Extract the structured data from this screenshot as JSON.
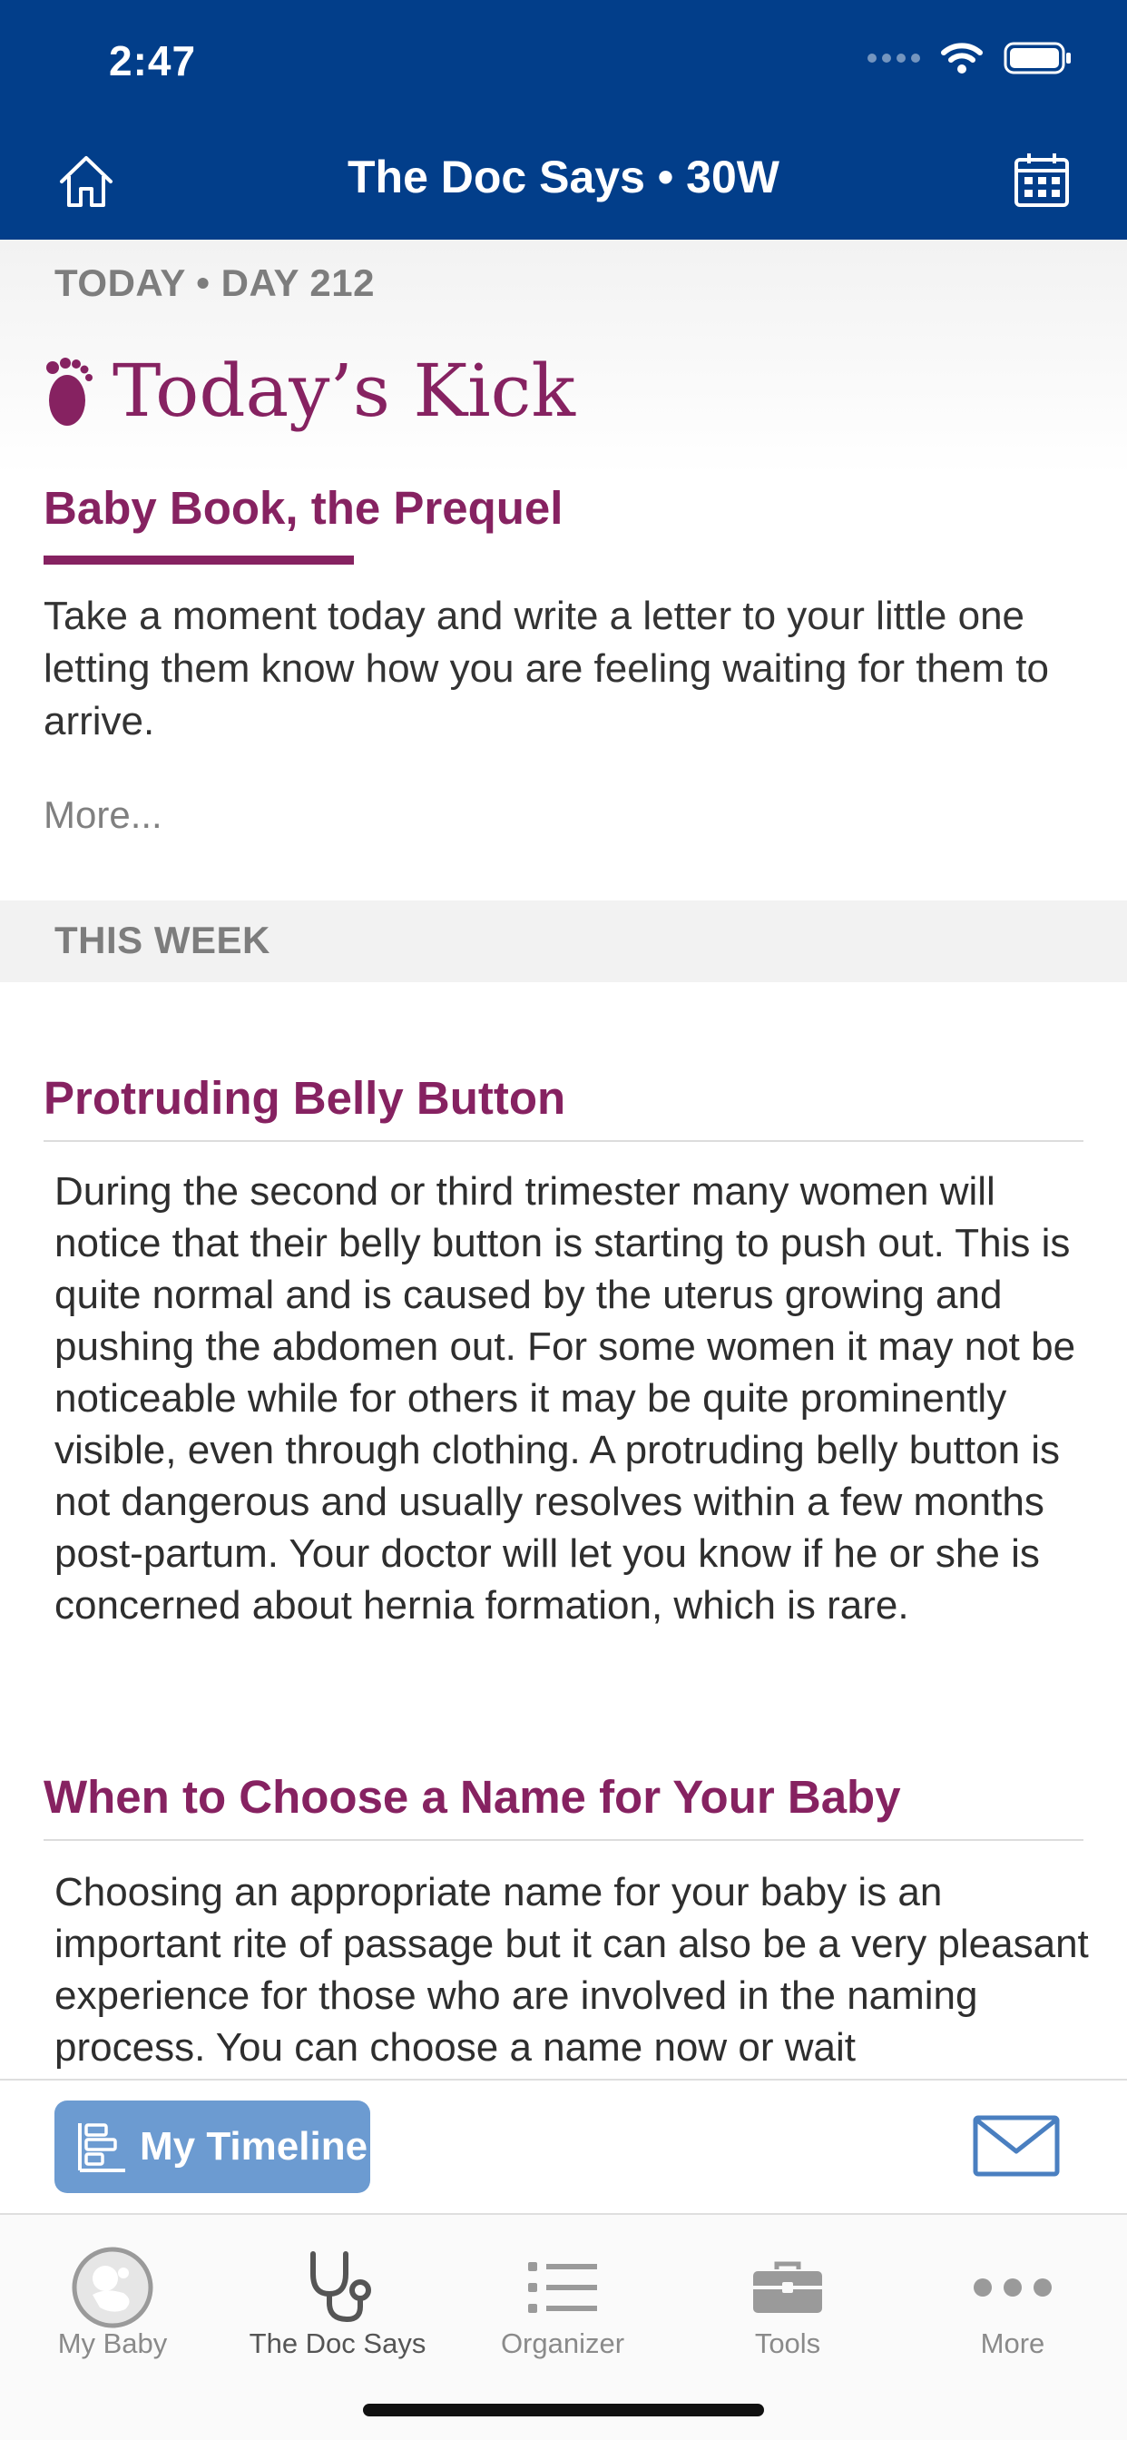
{
  "status_bar": {
    "time": "2:47"
  },
  "nav": {
    "title": "The Doc Says • 30W"
  },
  "today": {
    "label": "TODAY • DAY 212",
    "heading": "Today’s Kick",
    "tip_title": "Baby Book, the Prequel",
    "tip_body": "Take a moment today and write a letter to your little one letting them know how you are feeling waiting for them to arrive.",
    "more_link": "More..."
  },
  "this_week": {
    "label": "THIS WEEK",
    "articles": [
      {
        "title": "Protruding Belly Button",
        "body": "During the second or third trimester many women will notice that their belly button is starting to push out. This is quite normal and is caused by the uterus growing and pushing the abdomen out. For some women it may not be noticeable while for others it may be quite prominently visible, even through clothing. A protruding belly button is not dangerous and usually resolves within a few months post-partum. Your doctor will let you know if he or she is concerned about hernia formation, which is rare."
      },
      {
        "title": "When to Choose a Name for Your Baby",
        "body": "Choosing an appropriate name for your baby is an important rite of passage but it can also be a very pleasant experience for those who are involved in the naming process. You can choose a name now or wait"
      }
    ]
  },
  "action_bar": {
    "timeline_label": "My Timeline",
    "mail_icon": "envelope-icon"
  },
  "tabs": [
    {
      "label": "My Baby",
      "icon": "baby-icon"
    },
    {
      "label": "The Doc Says",
      "icon": "stethoscope-icon"
    },
    {
      "label": "Organizer",
      "icon": "list-icon"
    },
    {
      "label": "Tools",
      "icon": "toolbox-icon"
    },
    {
      "label": "More",
      "icon": "more-dots-icon"
    }
  ],
  "colors": {
    "header": "#023e8a",
    "accent": "#862261",
    "timeline_button": "#6c9bd1",
    "mail_icon": "#4a7fc0"
  }
}
